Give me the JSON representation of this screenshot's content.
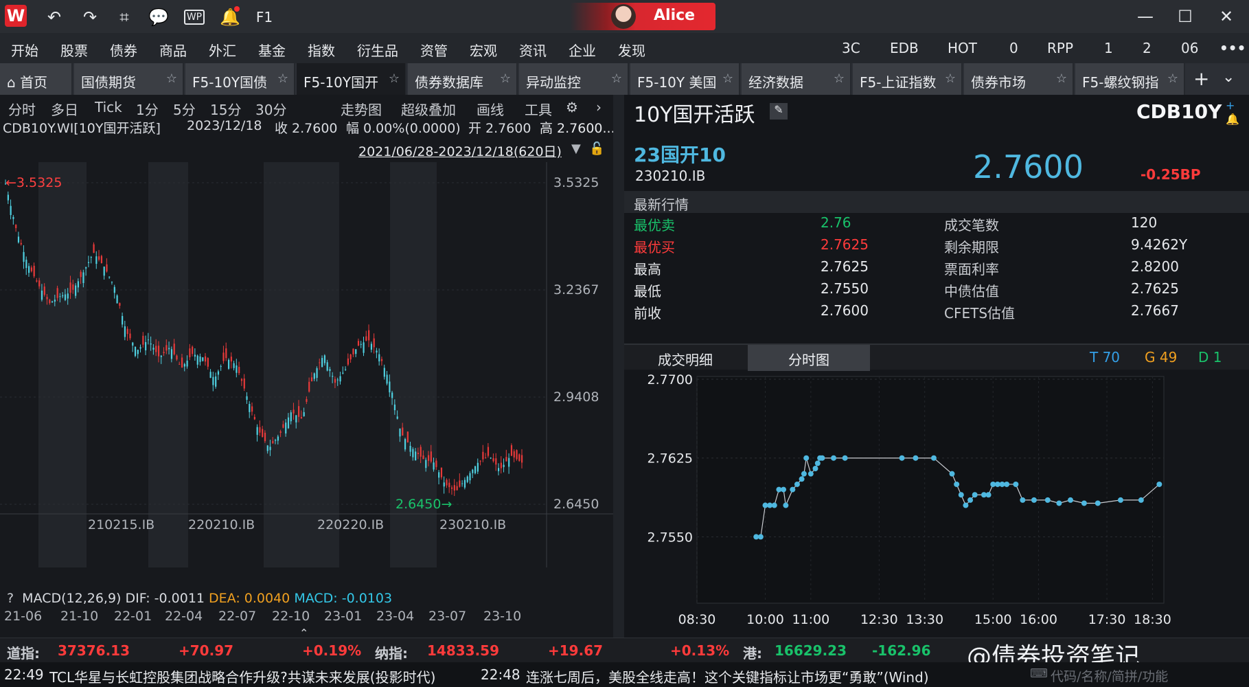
{
  "titlebar": {
    "logo": "W",
    "user": "Alice",
    "icons": [
      "undo-icon",
      "redo-icon",
      "crop-icon",
      "chat-icon",
      "wp-icon",
      "bell-icon",
      "f1-icon"
    ],
    "f1_label": "F1"
  },
  "menu": [
    "开始",
    "股票",
    "债券",
    "商品",
    "外汇",
    "基金",
    "指数",
    "衍生品",
    "资管",
    "宏观",
    "资讯",
    "企业",
    "发现"
  ],
  "menu_right": [
    "3C",
    "EDB",
    "HOT",
    "0",
    "RPP",
    "1",
    "2",
    "06"
  ],
  "tabs": [
    {
      "label": "首页"
    },
    {
      "label": "国债期货"
    },
    {
      "label": "F5-10Y国债"
    },
    {
      "label": "F5-10Y国开"
    },
    {
      "label": "债券数据库"
    },
    {
      "label": "异动监控"
    },
    {
      "label": "F5-10Y 美国"
    },
    {
      "label": "经济数据"
    },
    {
      "label": "F5-上证指数"
    },
    {
      "label": "债券市场"
    },
    {
      "label": "F5-螺纹钢指"
    }
  ],
  "period_tabs": [
    "分时",
    "多日",
    "Tick",
    "1分",
    "5分",
    "15分",
    "30分"
  ],
  "chart_tools": [
    "走势图",
    "超级叠加",
    "画线",
    "工具"
  ],
  "info": {
    "code": "CDB10Y.WI[10Y国开活跃]",
    "date": "2023/12/18",
    "close": "收 2.7600",
    "change": "幅 0.00%(0.0000)",
    "open": "开 2.7600",
    "high": "高 2.7600..."
  },
  "range": "2021/06/28-2023/12/18(620日)",
  "kline": {
    "y_ticks": [
      "3.5325",
      "3.2367",
      "2.9408",
      "2.6450"
    ],
    "max_label": "3.5325",
    "min_label": "2.6450",
    "bond_labels": [
      "210215.IB",
      "220210.IB",
      "220220.IB",
      "230210.IB"
    ],
    "date_labels": [
      "21-06",
      "21-10",
      "22-01",
      "22-04",
      "22-07",
      "22-10",
      "23-01",
      "23-04",
      "23-07",
      "23-10"
    ],
    "close_series": [
      3.53,
      3.4,
      3.31,
      3.25,
      3.2,
      3.22,
      3.23,
      3.28,
      3.34,
      3.3,
      3.24,
      3.12,
      3.07,
      3.1,
      3.05,
      3.08,
      3.02,
      3.06,
      3.05,
      2.99,
      3.05,
      3.03,
      2.94,
      2.85,
      2.8,
      2.84,
      2.9,
      2.88,
      3.0,
      3.06,
      2.98,
      3.02,
      3.08,
      3.1,
      3.06,
      2.98,
      2.84,
      2.8,
      2.77,
      2.76,
      2.7,
      2.68,
      2.72,
      2.76,
      2.78,
      2.74,
      2.78,
      2.76
    ]
  },
  "macd": {
    "label": "MACD(12,26,9)",
    "dif": "DIF: -0.0011",
    "dea": "DEA: 0.0040",
    "macd": "MACD: -0.0103"
  },
  "bond": {
    "title": "10Y国开活跃",
    "code": "CDB10Y",
    "name": "23国开10",
    "id": "230210.IB",
    "price": "2.7600",
    "change": "-0.25BP"
  },
  "quote_title": "最新行情",
  "quotes": [
    {
      "k1": "最优卖",
      "v1": "2.76",
      "k2": "成交笔数",
      "v2": "120"
    },
    {
      "k1": "最优买",
      "v1": "2.7625",
      "k2": "剩余期限",
      "v2": "9.4262Y"
    },
    {
      "k1": "最高",
      "v1": "2.7625",
      "k2": "票面利率",
      "v2": "2.8200"
    },
    {
      "k1": "最低",
      "v1": "2.7550",
      "k2": "中债估值",
      "v2": "2.7625"
    },
    {
      "k1": "前收",
      "v1": "2.7600",
      "k2": "CFETS估值",
      "v2": "2.7667"
    }
  ],
  "intraday_tabs": [
    "成交明细",
    "分时图"
  ],
  "tgd": {
    "t": "T 70",
    "g": "G 49",
    "d": "D 1"
  },
  "chart_data": {
    "type": "line",
    "y_ticks": [
      "2.7700",
      "2.7625",
      "2.7550"
    ],
    "x_ticks": [
      "08:30",
      "10:00",
      "11:00",
      "12:30",
      "13:30",
      "15:00",
      "16:00",
      "17:30",
      "18:30"
    ],
    "ylim": [
      2.75,
      2.77
    ],
    "x": [
      9.8,
      9.9,
      10.0,
      10.1,
      10.2,
      10.3,
      10.4,
      10.45,
      10.6,
      10.7,
      10.8,
      10.85,
      10.9,
      11.0,
      11.1,
      11.15,
      11.2,
      11.25,
      11.5,
      11.75,
      13.0,
      13.3,
      13.7,
      14.1,
      14.2,
      14.3,
      14.4,
      14.5,
      14.6,
      14.8,
      14.9,
      15.0,
      15.1,
      15.2,
      15.3,
      15.5,
      15.65,
      15.9,
      16.2,
      16.45,
      16.7,
      17.0,
      17.3,
      17.8,
      18.25,
      18.65
    ],
    "y": [
      2.755,
      2.755,
      2.758,
      2.758,
      2.758,
      2.7595,
      2.7595,
      2.758,
      2.7595,
      2.76,
      2.7605,
      2.761,
      2.7625,
      2.761,
      2.7615,
      2.762,
      2.7625,
      2.7625,
      2.7625,
      2.7625,
      2.7625,
      2.7625,
      2.7625,
      2.761,
      2.76,
      2.759,
      2.758,
      2.7585,
      2.759,
      2.759,
      2.759,
      2.76,
      2.76,
      2.76,
      2.76,
      2.76,
      2.7585,
      2.7585,
      2.7585,
      2.7582,
      2.7585,
      2.7582,
      2.7582,
      2.7585,
      2.7585,
      2.76
    ]
  },
  "ticker": [
    {
      "name": "道指:",
      "price": "37376.13",
      "chg": "+70.97",
      "pct": "+0.19%"
    },
    {
      "name": "纳指:",
      "price": "14833.59",
      "chg": "+19.67",
      "pct": "+0.13%"
    },
    {
      "name": "港:",
      "price": "16629.23",
      "chg": "-162.96",
      "pct": ""
    }
  ],
  "news": [
    {
      "time": "22:49",
      "text": "TCL华星与长虹控股集团战略合作升级?共谋未来发展(投影时代)"
    },
    {
      "time": "22:48",
      "text": "连涨七周后，美股全线走高！这个关键指标让市场更“勇敢”(Wind)"
    }
  ],
  "search_hint": "代码/名称/简拼/功能",
  "watermark": "@债券投资笔记"
}
